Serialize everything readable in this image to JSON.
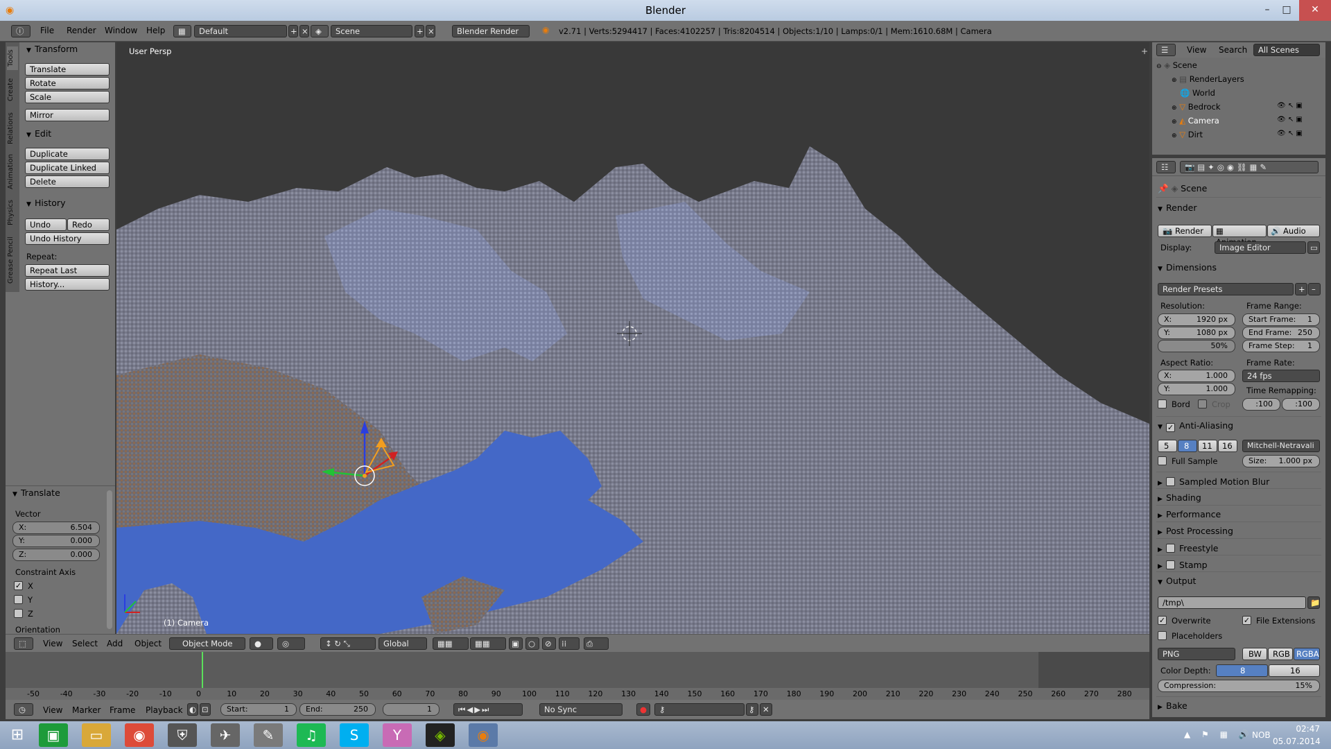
{
  "window": {
    "title": "Blender"
  },
  "menubar": {
    "menus": [
      "File",
      "Render",
      "Window",
      "Help"
    ],
    "screen_layout": "Default",
    "scene": "Scene",
    "engine": "Blender Render",
    "status": "v2.71 | Verts:5294417 | Faces:4102257 | Tris:8204514 | Objects:1/10 | Lamps:0/1 | Mem:1610.68M | Camera"
  },
  "tool_tabs": [
    "Tools",
    "Create",
    "Relations",
    "Animation",
    "Physics",
    "Grease Pencil"
  ],
  "tools": {
    "transform_header": "Transform",
    "transform_buttons": [
      "Translate",
      "Rotate",
      "Scale",
      "Mirror"
    ],
    "edit_header": "Edit",
    "edit_buttons": [
      "Duplicate",
      "Duplicate Linked",
      "Delete"
    ],
    "history_header": "History",
    "undo": "Undo",
    "redo": "Redo",
    "undo_history": "Undo History",
    "repeat_label": "Repeat:",
    "repeat_last": "Repeat Last",
    "history_btn": "History..."
  },
  "operator": {
    "header": "Translate",
    "vector_label": "Vector",
    "x_label": "X:",
    "x": "6.504",
    "y_label": "Y:",
    "y": "0.000",
    "z_label": "Z:",
    "z": "0.000",
    "constraint_label": "Constraint Axis",
    "cx": "X",
    "cy": "Y",
    "cz": "Z",
    "orientation_label": "Orientation"
  },
  "viewport": {
    "view_name": "User Persp",
    "object_name": "(1) Camera"
  },
  "vpheader": {
    "menus": [
      "View",
      "Select",
      "Add",
      "Object"
    ],
    "mode": "Object Mode",
    "orientation": "Global"
  },
  "timeline": {
    "ticks": [
      "-50",
      "-40",
      "-30",
      "-20",
      "-10",
      "0",
      "10",
      "20",
      "30",
      "40",
      "50",
      "60",
      "70",
      "80",
      "90",
      "100",
      "110",
      "120",
      "130",
      "140",
      "150",
      "160",
      "170",
      "180",
      "190",
      "200",
      "210",
      "220",
      "230",
      "240",
      "250",
      "260",
      "270",
      "280"
    ],
    "menus": [
      "View",
      "Marker",
      "Frame",
      "Playback"
    ],
    "start_label": "Start:",
    "start": "1",
    "end_label": "End:",
    "end": "250",
    "current": "1",
    "sync": "No Sync"
  },
  "outliner": {
    "menus": [
      "View",
      "Search"
    ],
    "filter": "All Scenes",
    "items": [
      "Scene",
      "RenderLayers",
      "World",
      "Bedrock",
      "Camera",
      "Dirt"
    ]
  },
  "properties": {
    "context": "Scene",
    "render_header": "Render",
    "render_btn": "Render",
    "animation_btn": "Animation",
    "audio_btn": "Audio",
    "display_label": "Display:",
    "display_value": "Image Editor",
    "dimensions_header": "Dimensions",
    "render_presets": "Render Presets",
    "resolution_label": "Resolution:",
    "res_x_label": "X:",
    "res_x": "1920 px",
    "res_y_label": "Y:",
    "res_y": "1080 px",
    "res_pct": "50%",
    "frame_range_label": "Frame Range:",
    "start_frame_label": "Start Frame:",
    "start_frame": "1",
    "end_frame_label": "End Frame:",
    "end_frame": "250",
    "frame_step_label": "Frame Step:",
    "frame_step": "1",
    "aspect_label": "Aspect Ratio:",
    "asp_x_label": "X:",
    "asp_x": "1.000",
    "asp_y_label": "Y:",
    "asp_y": "1.000",
    "frame_rate_label": "Frame Rate:",
    "frame_rate": "24 fps",
    "time_remap_label": "Time Remapping:",
    "remap_old": ":100",
    "remap_new": ":100",
    "bord": "Bord",
    "crop": "Crop",
    "aa_header": "Anti-Aliasing",
    "aa_samples": [
      "5",
      "8",
      "11",
      "16"
    ],
    "aa_filter": "Mitchell-Netravali",
    "full_sample": "Full Sample",
    "size_label": "Size:",
    "size": "1.000 px",
    "collapsed": [
      "Sampled Motion Blur",
      "Shading",
      "Performance",
      "Post Processing",
      "Freestyle",
      "Stamp"
    ],
    "output_header": "Output",
    "output_path": "/tmp\\",
    "overwrite": "Overwrite",
    "file_ext": "File Extensions",
    "placeholders": "Placeholders",
    "format": "PNG",
    "color_modes": [
      "BW",
      "RGB",
      "RGBA"
    ],
    "color_depth_label": "Color Depth:",
    "depth_8": "8",
    "depth_16": "16",
    "compression_label": "Compression:",
    "compression": "15%",
    "bake": "Bake"
  },
  "taskbar": {
    "lang": "NOB",
    "time": "02:47",
    "date": "05.07.2014"
  }
}
